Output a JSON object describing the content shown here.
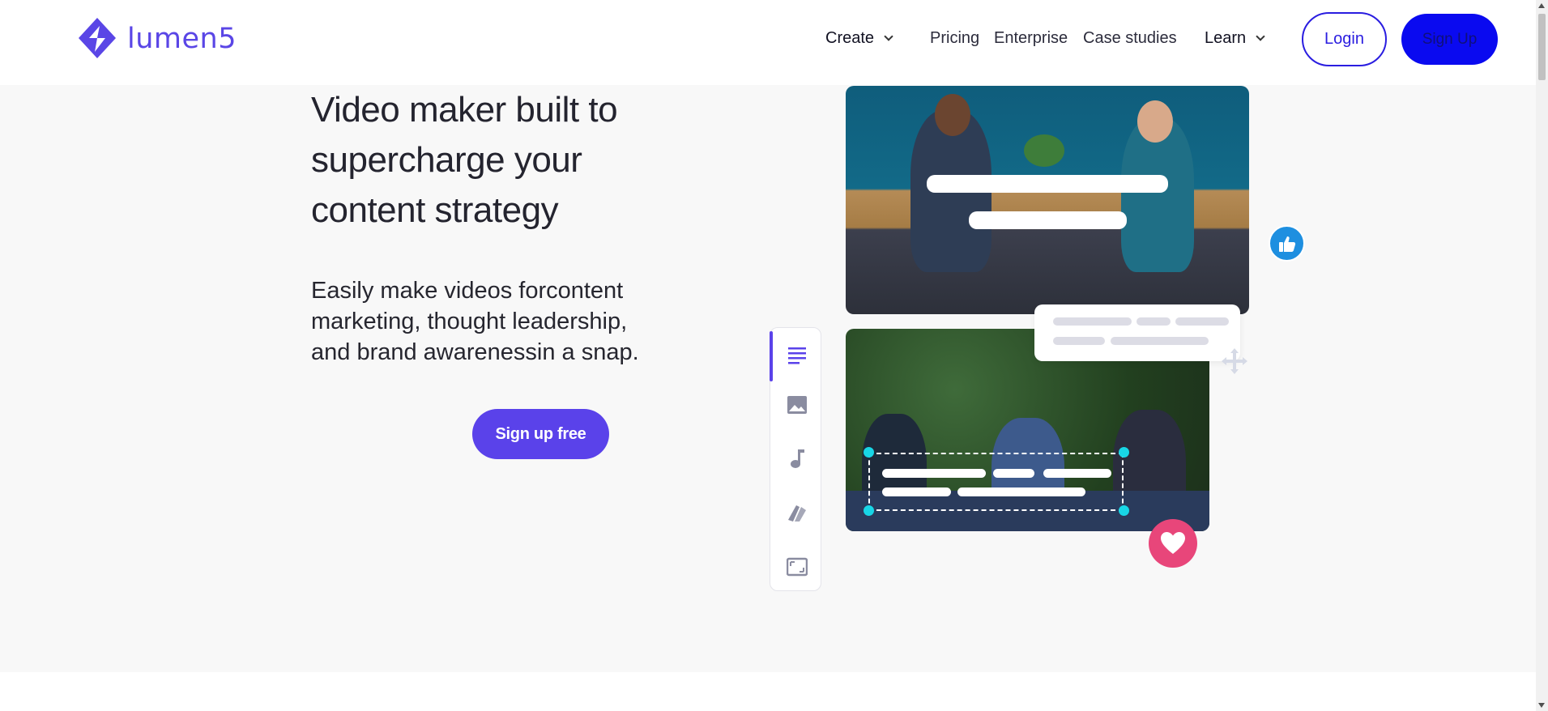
{
  "brand": {
    "name": "lumen5",
    "accent": "#5a46e6"
  },
  "nav": {
    "create": "Create",
    "pricing": "Pricing",
    "enterprise": "Enterprise",
    "case_studies": "Case studies",
    "learn": "Learn"
  },
  "header_buttons": {
    "login": "Login",
    "signup": "Sign Up"
  },
  "hero": {
    "title": "Video maker built to supercharge your content strategy",
    "subtitle": "Easily make videos forcontent marketing, thought leadership, and brand awarenessin a snap.",
    "cta": "Sign up free"
  },
  "editor_panel": {
    "icons": [
      "text-lines-icon",
      "image-icon",
      "music-note-icon",
      "color-swatch-icon",
      "aspect-ratio-icon"
    ],
    "active_tool": "text-lines-icon"
  },
  "badges": {
    "like": "thumbs-up-icon",
    "love": "heart-icon",
    "move": "move-arrows-icon"
  },
  "colors": {
    "primary_button": "#5a42ea",
    "signup_button": "#0a0af0",
    "login_border": "#2a1de0",
    "like": "#1e8fe0",
    "love": "#e8467a",
    "handles": "#18d6e6"
  }
}
